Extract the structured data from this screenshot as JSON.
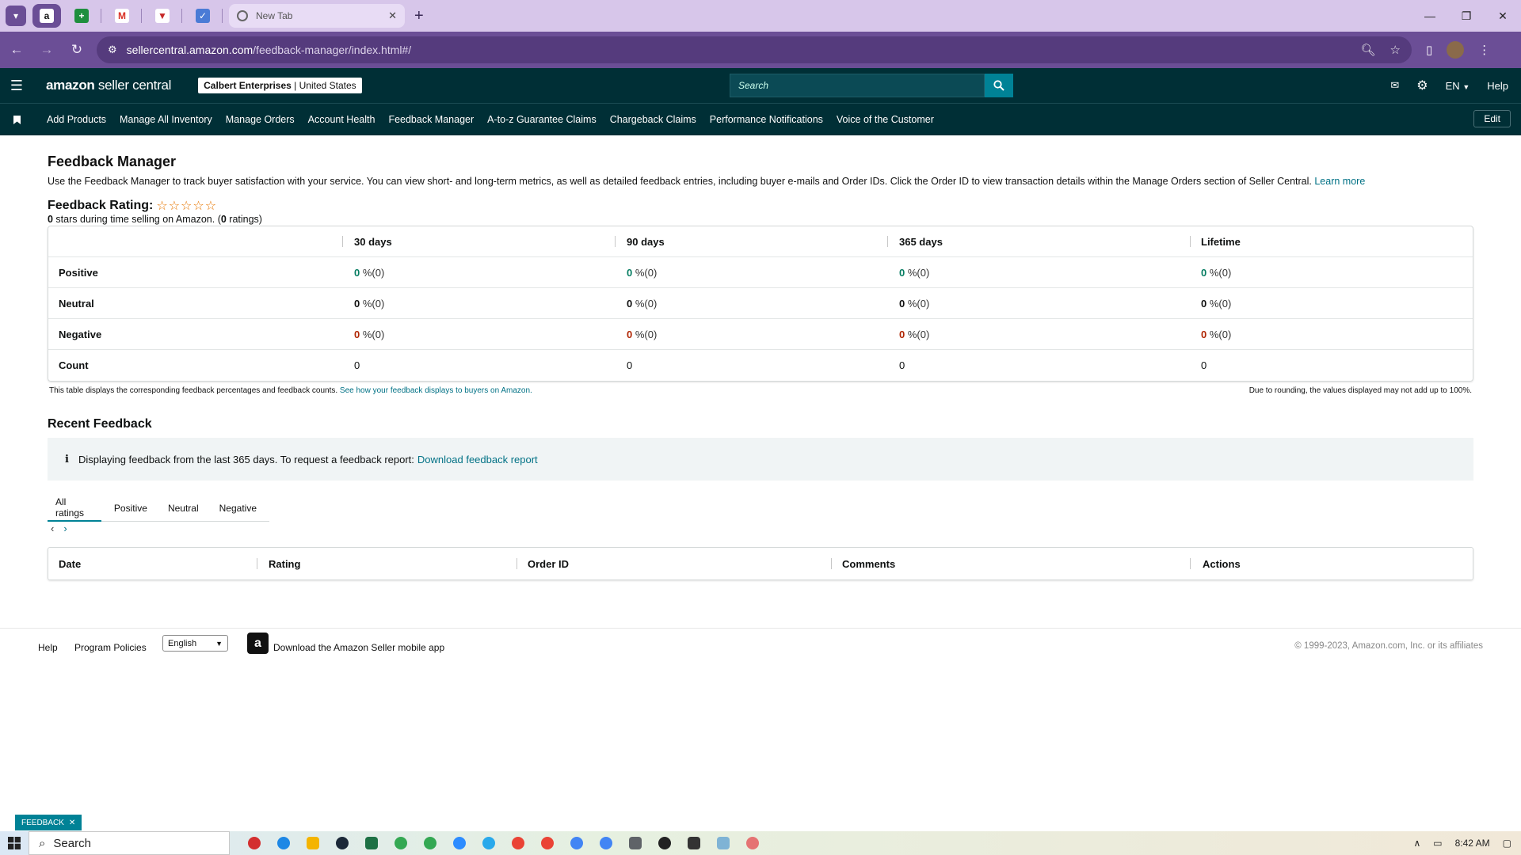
{
  "browser": {
    "tabs": [
      {
        "name": "amazon",
        "letter": "a"
      },
      {
        "name": "sheets",
        "letter": "+"
      },
      {
        "name": "gmail",
        "letter": "M"
      },
      {
        "name": "vivaldi",
        "letter": "▼"
      },
      {
        "name": "workona",
        "letter": "✓"
      }
    ],
    "new_tab_title": "New Tab",
    "url_host": "sellercentral.amazon.com",
    "url_path": "/feedback-manager/index.html#/"
  },
  "header": {
    "logo_bold": "amazon",
    "logo_rest": " seller central",
    "merchant_name": "Calbert Enterprises",
    "merchant_sep": " | ",
    "merchant_region": "United States",
    "search_placeholder": "Search",
    "language": "EN",
    "help": "Help"
  },
  "nav": {
    "items": [
      "Add Products",
      "Manage All Inventory",
      "Manage Orders",
      "Account Health",
      "Feedback Manager",
      "A-to-z Guarantee Claims",
      "Chargeback Claims",
      "Performance Notifications",
      "Voice of the Customer"
    ],
    "edit": "Edit"
  },
  "page": {
    "title": "Feedback Manager",
    "description": "Use the Feedback Manager to track buyer satisfaction with your service. You can view short- and long-term metrics, as well as detailed feedback entries, including buyer e-mails and Order IDs. Click the Order ID to view transaction details within the Manage Orders section of Seller Central. ",
    "learn_more": "Learn more",
    "rating_label": "Feedback Rating:",
    "stars": "☆☆☆☆☆",
    "rating_value": "0",
    "rating_mid": " stars during time selling on Amazon. (",
    "rating_count": "0",
    "rating_tail": " ratings)"
  },
  "feedback_table": {
    "columns": [
      "",
      "30 days",
      "90 days",
      "365 days",
      "Lifetime"
    ],
    "rows": [
      {
        "label": "Positive",
        "kind": "pos",
        "values": [
          "0",
          "0",
          "0",
          "0"
        ],
        "suffix": "%(0)"
      },
      {
        "label": "Neutral",
        "kind": "neu",
        "values": [
          "0",
          "0",
          "0",
          "0"
        ],
        "suffix": "%(0)"
      },
      {
        "label": "Negative",
        "kind": "neg",
        "values": [
          "0",
          "0",
          "0",
          "0"
        ],
        "suffix": "%(0)"
      },
      {
        "label": "Count",
        "kind": "count",
        "values": [
          "0",
          "0",
          "0",
          "0"
        ],
        "suffix": ""
      }
    ],
    "note": "This table displays the corresponding feedback percentages and feedback counts. ",
    "note_link": "See how your feedback displays to buyers on Amazon.",
    "note_right": "Due to rounding, the values displayed may not add up to 100%."
  },
  "recent": {
    "title": "Recent Feedback",
    "info_text": "Displaying feedback from the last 365 days. To request a feedback report: ",
    "info_link": "Download feedback report",
    "tabs": [
      "All ratings",
      "Positive",
      "Neutral",
      "Negative"
    ],
    "active_tab": "All ratings",
    "columns": [
      "Date",
      "Rating",
      "Order ID",
      "Comments",
      "Actions"
    ]
  },
  "footer": {
    "help": "Help",
    "program_policies": "Program Policies",
    "language_selected": "English",
    "app_text": "Download the Amazon Seller mobile app",
    "copyright": "© 1999-2023, Amazon.com, Inc. or its affiliates",
    "feedback_tab": "FEEDBACK"
  },
  "taskbar": {
    "search": "Search",
    "time": "8:42 AM"
  },
  "colors": {
    "seller_central_bg": "#002f36",
    "browser_accent": "#6b4e96",
    "link": "#007185",
    "positive": "#067d62",
    "negative": "#b12704"
  }
}
